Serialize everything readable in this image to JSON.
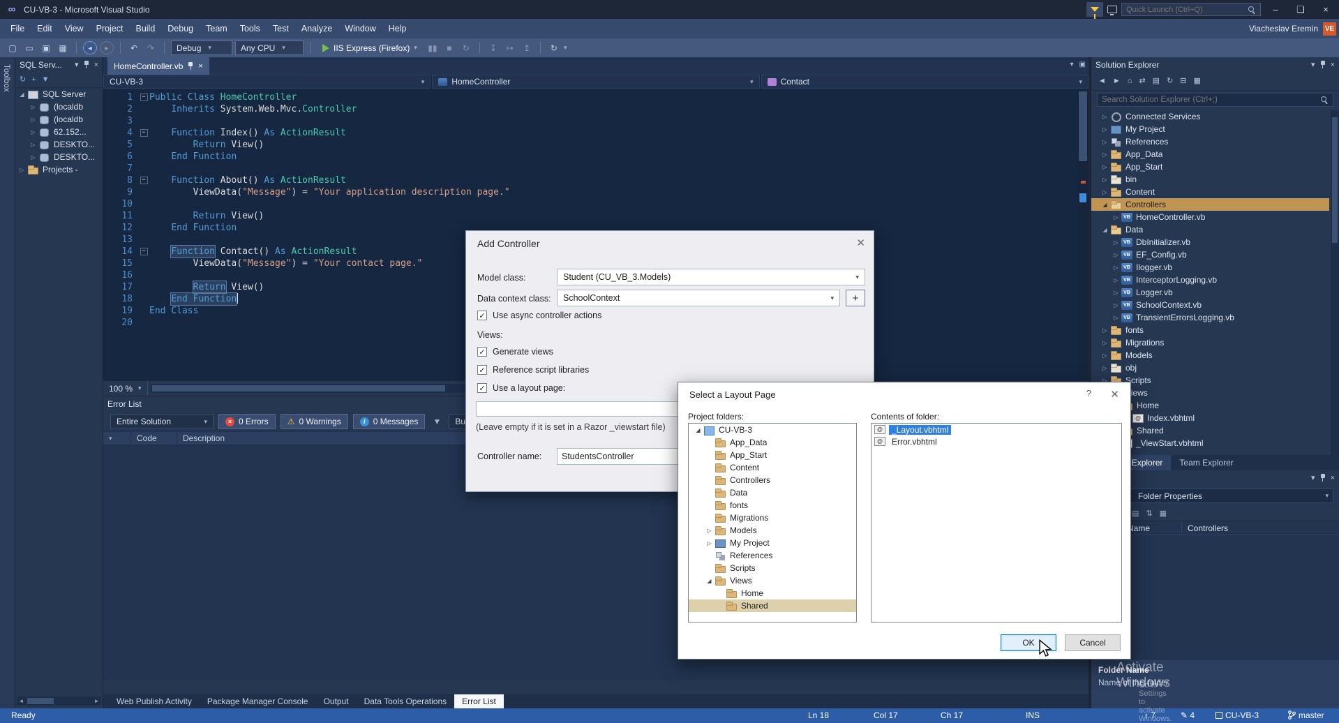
{
  "window": {
    "title": "CU-VB-3 - Microsoft Visual Studio",
    "quick_launch_placeholder": "Quick Launch (Ctrl+Q)",
    "user_name": "Viacheslav Eremin",
    "user_badge": "VE"
  },
  "menubar": {
    "items": [
      "File",
      "Edit",
      "View",
      "Project",
      "Build",
      "Debug",
      "Team",
      "Tools",
      "Test",
      "Analyze",
      "Window",
      "Help"
    ]
  },
  "toolbar": {
    "config": "Debug",
    "platform": "Any CPU",
    "run_target": "IIS Express (Firefox)"
  },
  "toolbox_tab": "Toolbox",
  "sql_explorer": {
    "title": "SQL Serv...",
    "toolbar_icons": [
      "refresh",
      "add-server",
      "filter"
    ],
    "tree": [
      {
        "label": "SQL Server",
        "indent": 0,
        "arrow": "down",
        "icon": "server"
      },
      {
        "label": "(localdb",
        "indent": 1,
        "arrow": "right",
        "icon": "db"
      },
      {
        "label": "(localdb",
        "indent": 1,
        "arrow": "right",
        "icon": "db"
      },
      {
        "label": "62.152...",
        "indent": 1,
        "arrow": "right",
        "icon": "db"
      },
      {
        "label": "DESKTO...",
        "indent": 1,
        "arrow": "right",
        "icon": "db"
      },
      {
        "label": "DESKTO...",
        "indent": 1,
        "arrow": "right",
        "icon": "db"
      },
      {
        "label": "Projects -",
        "indent": 0,
        "arrow": "right",
        "icon": "folder"
      }
    ]
  },
  "editor": {
    "tab_title": "HomeController.vb",
    "breadcrumb": {
      "project": "CU-VB-3",
      "type": "HomeController",
      "member": "Contact"
    },
    "zoom": "100 %",
    "code": [
      {
        "n": 1,
        "f": true,
        "s": [
          [
            "Public Class ",
            "kw"
          ],
          [
            "HomeController",
            "type"
          ]
        ]
      },
      {
        "n": 2,
        "s": [
          [
            "    ",
            "pl"
          ],
          [
            "Inherits",
            "kw"
          ],
          [
            " System.Web.Mvc.",
            "pl"
          ],
          [
            "Controller",
            "type"
          ]
        ]
      },
      {
        "n": 3,
        "s": []
      },
      {
        "n": 4,
        "f": true,
        "s": [
          [
            "    ",
            "pl"
          ],
          [
            "Function",
            "kw"
          ],
          [
            " Index() ",
            "pl"
          ],
          [
            "As",
            "kw"
          ],
          [
            " ",
            "pl"
          ],
          [
            "ActionResult",
            "type"
          ]
        ]
      },
      {
        "n": 5,
        "s": [
          [
            "        ",
            "pl"
          ],
          [
            "Return",
            "kw"
          ],
          [
            " View()",
            "pl"
          ]
        ]
      },
      {
        "n": 6,
        "s": [
          [
            "    ",
            "pl"
          ],
          [
            "End Function",
            "kw"
          ]
        ]
      },
      {
        "n": 7,
        "s": []
      },
      {
        "n": 8,
        "f": true,
        "s": [
          [
            "    ",
            "pl"
          ],
          [
            "Function",
            "kw"
          ],
          [
            " About() ",
            "pl"
          ],
          [
            "As",
            "kw"
          ],
          [
            " ",
            "pl"
          ],
          [
            "ActionResult",
            "type"
          ]
        ]
      },
      {
        "n": 9,
        "s": [
          [
            "        ViewData(",
            "pl"
          ],
          [
            "\"Message\"",
            "str"
          ],
          [
            ") = ",
            "pl"
          ],
          [
            "\"Your application description page.\"",
            "str"
          ]
        ]
      },
      {
        "n": 10,
        "s": []
      },
      {
        "n": 11,
        "s": [
          [
            "        ",
            "pl"
          ],
          [
            "Return",
            "kw"
          ],
          [
            " View()",
            "pl"
          ]
        ]
      },
      {
        "n": 12,
        "s": [
          [
            "    ",
            "pl"
          ],
          [
            "End Function",
            "kw"
          ]
        ]
      },
      {
        "n": 13,
        "s": []
      },
      {
        "n": 14,
        "f": true,
        "s": [
          [
            "    ",
            "pl"
          ],
          [
            "Function",
            "kw hl"
          ],
          [
            " Contact() ",
            "pl"
          ],
          [
            "As",
            "kw"
          ],
          [
            " ",
            "pl"
          ],
          [
            "ActionResult",
            "type"
          ]
        ]
      },
      {
        "n": 15,
        "s": [
          [
            "        ViewData(",
            "pl"
          ],
          [
            "\"Message\"",
            "str"
          ],
          [
            ") = ",
            "pl"
          ],
          [
            "\"Your contact page.\"",
            "str"
          ]
        ]
      },
      {
        "n": 16,
        "s": []
      },
      {
        "n": 17,
        "s": [
          [
            "        ",
            "pl"
          ],
          [
            "Return",
            "kw hl"
          ],
          [
            " View()",
            "pl"
          ]
        ]
      },
      {
        "n": 18,
        "s": [
          [
            "    ",
            "pl"
          ],
          [
            "End Function",
            "kw hl"
          ],
          [
            "",
            "caret"
          ]
        ]
      },
      {
        "n": 19,
        "s": [
          [
            "End Class",
            "kw"
          ]
        ]
      },
      {
        "n": 20,
        "s": []
      }
    ]
  },
  "error_list": {
    "title": "Error List",
    "scope": "Entire Solution",
    "errors_label": "0 Errors",
    "warnings_label": "0 Warnings",
    "messages_label": "0 Messages",
    "build_filter": "Build +",
    "columns": [
      "Code",
      "Description"
    ]
  },
  "bottom_tabs": [
    {
      "label": "Web Publish Activity"
    },
    {
      "label": "Package Manager Console"
    },
    {
      "label": "Output"
    },
    {
      "label": "Data Tools Operations"
    },
    {
      "label": "Error List",
      "active": true
    }
  ],
  "add_controller_dialog": {
    "title": "Add Controller",
    "model_class_label": "Model class:",
    "model_class_value": "Student (CU_VB_3.Models)",
    "data_context_label": "Data context class:",
    "data_context_value": "SchoolContext",
    "add_context_button": "+",
    "async_label": "Use async controller actions",
    "views_label": "Views:",
    "generate_views_label": "Generate views",
    "reference_scripts_label": "Reference script libraries",
    "use_layout_label": "Use a layout page:",
    "layout_value": "",
    "layout_hint": "(Leave empty if it is set in a Razor _viewstart file)",
    "controller_name_label": "Controller name:",
    "controller_name_value": "StudentsController"
  },
  "layout_dialog": {
    "title": "Select a Layout Page",
    "help_button": "?",
    "project_folders_label": "Project folders:",
    "contents_label": "Contents of folder:",
    "tree": [
      {
        "label": "CU-VB-3",
        "indent": 0,
        "arrow": "down",
        "icon": "project"
      },
      {
        "label": "App_Data",
        "indent": 1,
        "icon": "folder"
      },
      {
        "label": "App_Start",
        "indent": 1,
        "icon": "folder"
      },
      {
        "label": "Content",
        "indent": 1,
        "icon": "folder"
      },
      {
        "label": "Controllers",
        "indent": 1,
        "icon": "folder"
      },
      {
        "label": "Data",
        "indent": 1,
        "icon": "folder"
      },
      {
        "label": "fonts",
        "indent": 1,
        "icon": "folder"
      },
      {
        "label": "Migrations",
        "indent": 1,
        "icon": "folder"
      },
      {
        "label": "Models",
        "indent": 1,
        "arrow": "right",
        "icon": "folder"
      },
      {
        "label": "My Project",
        "indent": 1,
        "arrow": "right",
        "icon": "myproject"
      },
      {
        "label": "References",
        "indent": 1,
        "icon": "references"
      },
      {
        "label": "Scripts",
        "indent": 1,
        "icon": "folder"
      },
      {
        "label": "Views",
        "indent": 1,
        "arrow": "down",
        "icon": "folder"
      },
      {
        "label": "Home",
        "indent": 2,
        "icon": "folder"
      },
      {
        "label": "Shared",
        "indent": 2,
        "icon": "folder",
        "selected": true
      }
    ],
    "files": [
      {
        "label": "_Layout.vbhtml",
        "icon": "razor",
        "selected": true
      },
      {
        "label": "Error.vbhtml",
        "icon": "razor"
      }
    ],
    "ok_button": "OK",
    "cancel_button": "Cancel"
  },
  "solution_explorer": {
    "title": "Solution Explorer",
    "search_placeholder": "Search Solution Explorer (Ctrl+;)",
    "toolbar_icons": [
      "back",
      "forward",
      "home",
      "switch-views",
      "pending-changes",
      "refresh",
      "collapse-all",
      "properties"
    ],
    "tree": [
      {
        "label": "Connected Services",
        "indent": 0,
        "arrow": "right",
        "icon": "services"
      },
      {
        "label": "My Project",
        "indent": 0,
        "arrow": "right",
        "icon": "myproject"
      },
      {
        "label": "References",
        "indent": 0,
        "arrow": "right",
        "icon": "references"
      },
      {
        "label": "App_Data",
        "indent": 0,
        "arrow": "right",
        "icon": "folder"
      },
      {
        "label": "App_Start",
        "indent": 0,
        "arrow": "right",
        "icon": "folder"
      },
      {
        "label": "bin",
        "indent": 0,
        "arrow": "right",
        "icon": "folder-plain"
      },
      {
        "label": "Content",
        "indent": 0,
        "arrow": "right",
        "icon": "folder"
      },
      {
        "label": "Controllers",
        "indent": 0,
        "arrow": "down",
        "icon": "folder-open",
        "selected": true
      },
      {
        "label": "HomeController.vb",
        "indent": 1,
        "arrow": "right",
        "icon": "vb"
      },
      {
        "label": "Data",
        "indent": 0,
        "arrow": "down",
        "icon": "folder-open"
      },
      {
        "label": "DbInitializer.vb",
        "indent": 1,
        "arrow": "right",
        "icon": "vb"
      },
      {
        "label": "EF_Config.vb",
        "indent": 1,
        "arrow": "right",
        "icon": "vb"
      },
      {
        "label": "Ilogger.vb",
        "indent": 1,
        "arrow": "right",
        "icon": "vb"
      },
      {
        "label": "InterceptorLogging.vb",
        "indent": 1,
        "arrow": "right",
        "icon": "vb"
      },
      {
        "label": "Logger.vb",
        "indent": 1,
        "arrow": "right",
        "icon": "vb"
      },
      {
        "label": "SchoolContext.vb",
        "indent": 1,
        "arrow": "right",
        "icon": "vb"
      },
      {
        "label": "TransientErrorsLogging.vb",
        "indent": 1,
        "arrow": "right",
        "icon": "vb"
      },
      {
        "label": "fonts",
        "indent": 0,
        "arrow": "right",
        "icon": "folder"
      },
      {
        "label": "Migrations",
        "indent": 0,
        "arrow": "right",
        "icon": "folder"
      },
      {
        "label": "Models",
        "indent": 0,
        "arrow": "right",
        "icon": "folder"
      },
      {
        "label": "obj",
        "indent": 0,
        "arrow": "right",
        "icon": "folder-plain"
      },
      {
        "label": "Scripts",
        "indent": 0,
        "arrow": "right",
        "icon": "folder"
      },
      {
        "label": "Views",
        "indent": 0,
        "arrow": "down",
        "icon": "folder"
      },
      {
        "label": "Home",
        "indent": 1,
        "arrow": "down",
        "icon": "folder"
      },
      {
        "label": "Index.vbhtml",
        "indent": 2,
        "arrow": "right",
        "icon": "razor"
      },
      {
        "label": "Shared",
        "indent": 1,
        "arrow": "right",
        "icon": "folder"
      },
      {
        "label": "_ViewStart.vbhtml",
        "indent": 1,
        "arrow": "right",
        "icon": "razor"
      }
    ],
    "tabs": [
      {
        "label": "Solution Explorer",
        "active": true
      },
      {
        "label": "Team Explorer"
      }
    ]
  },
  "properties": {
    "object_selector": "Folder Properties",
    "rows": [
      {
        "name": "Name",
        "value": "Controllers"
      }
    ],
    "help_title": "Folder Name",
    "help_text": "Name of this folder"
  },
  "watermark": {
    "line1": "Activate Windows",
    "line2": "Go to Settings to activate Windows."
  },
  "statusbar": {
    "ready": "Ready",
    "line": "Ln 18",
    "column": "Col 17",
    "character": "Ch 17",
    "mode": "INS",
    "pushes": "7",
    "changes": "4",
    "repository": "CU-VB-3",
    "branch": "master"
  },
  "colors": {
    "selection_gold": "#c09553",
    "selection_blue": "#2f80e0",
    "status_bar_blue": "#2e5da8",
    "error_red": "#e04a3f",
    "warning_yellow": "#ffcc33",
    "info_blue": "#3794d6",
    "keyword_blue": "#569cd6",
    "type_teal": "#4ec9b0",
    "string_salmon": "#d69d85"
  }
}
